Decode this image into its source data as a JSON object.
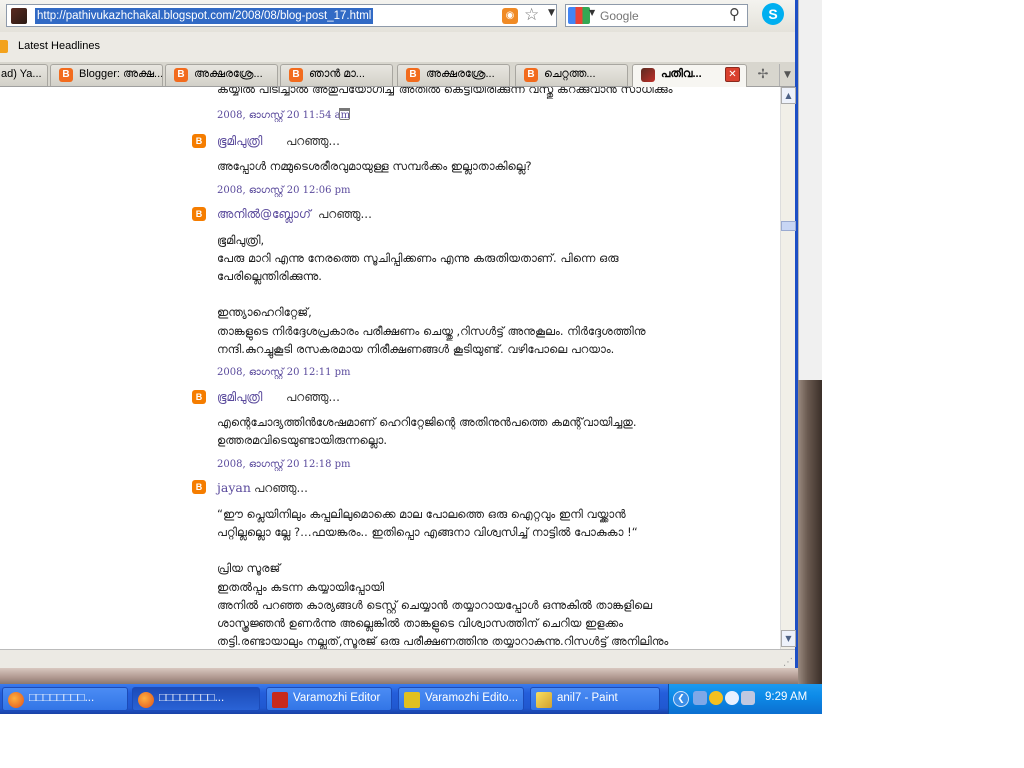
{
  "browser": {
    "url": "http://pathivukazhchakal.blogspot.com/2008/08/blog-post_17.html",
    "search_placeholder": "Google",
    "bookmarks": {
      "item": "Latest Headlines"
    },
    "tabs": [
      {
        "label": "ad) Ya..."
      },
      {
        "label": "Blogger: അക്ഷ..."
      },
      {
        "label": "അക്ഷരശ്രേ..."
      },
      {
        "label": "ഞാൻ മാ..."
      },
      {
        "label": "അക്ഷരശ്രേ..."
      },
      {
        "label": "ചെറ്റത്ത..."
      },
      {
        "label": "പതിവ..."
      }
    ]
  },
  "comments": {
    "c0": {
      "text": "കയ്യിൽ പിടിച്ചാൽ അതുപയോഗിച്ച് അതിൽ കെട്ടിയിരിക്കുന്ന വസ്തു കറക്കുവാൻ സാധിക്കും",
      "time": "2008, ഓഗസ്റ്റ് 20 11:54 am"
    },
    "c1": {
      "author": "ഭൂമിപുത്രി",
      "said": "പറഞ്ഞു...",
      "lines": [
        "അപ്പോൾ നമ്മുടെശരീരവുമായുള്ള സമ്പർക്കം ഇല്ലാതാകില്ലെ?"
      ],
      "time": "2008, ഓഗസ്റ്റ് 20 12:06 pm"
    },
    "c2": {
      "author": "അനിൽ@ബ്ലോഗ്",
      "said": "പറഞ്ഞു...",
      "lines": [
        "ഭൂമിപുത്രി,",
        "പേരു മാറി എന്നു നേരത്തെ സൂചിപ്പിക്കണം എന്നു കരുതിയതാണ്. പിന്നെ ഒരു",
        "പേരില്ലെന്തിരിക്കുന്നു.",
        "ഇന്ത്യാഹെറിറ്റേജ്,",
        "താങ്കളുടെ നിർദ്ദേശപ്രകാരം പരീക്ഷണം ചെയ്തു ,റിസൾട്ട് അനുകൂലം. നിർദ്ദേശത്തിനു",
        "നന്ദി.കുറച്ചുകൂടി രസകരമായ നിരീക്ഷണങ്ങൾ കൂടിയുണ്ട്. വഴിപോലെ പറയാം."
      ],
      "time": "2008, ഓഗസ്റ്റ് 20 12:11 pm"
    },
    "c3": {
      "author": "ഭൂമിപുത്രി",
      "said": "പറഞ്ഞു...",
      "lines": [
        "എന്റെചോദ്യത്തിൻശേഷമാണ് ഹെറിറ്റേജിന്റെ അതിനുൻപത്തെ കമന്റ്‌വായിച്ചതു.",
        "ഉത്തരമവിടെയുണ്ടായിരുന്നല്ലൊ."
      ],
      "time": "2008, ഓഗസ്റ്റ് 20 12:18 pm"
    },
    "c4": {
      "author": "jayan",
      "said": "പറഞ്ഞു...",
      "lines": [
        "“ഈ പ്ലെയിനിലും കപ്പലിലുമൊക്കെ മാല പോലത്തെ ഒരു ഐറ്റവും ഇനി വയ്ക്കാൻ",
        "പറ്റില്ലല്ലൊ ല്ലേ ?…ഫയങ്കരം.. ഇതിപ്പൊ എങ്ങനാ വിശ്വസിച്ച് നാട്ടിൽ പോകുകാ !“",
        "പ്രിയ സൂരജ്",
        "ഇതൽപ്പം കടന്ന കയ്യായിപ്പോയി",
        "അനിൽ പറഞ്ഞ കാര്യങ്ങൾ ടെസ്റ്റ് ചെയ്യാൻ തയ്യാറായപ്പോൾ ഒന്നുകിൽ താങ്കളിലെ",
        "ശാസ്ത്രജ്ഞൻ ഉണർന്നു അല്ലെങ്കിൽ താങ്കളുടെ വിശ്വാസത്തിന് ചെറിയ ഇളക്കം",
        "തട്ടി.രണ്ടായാലും നല്ലത്,സൂരജ് ഒരു പരീക്ഷണത്തിനു തയ്യാറാകുന്നു.റിസൾട്ട് അനിലിനും"
      ]
    }
  },
  "taskbar": {
    "tasks": [
      {
        "label": "□□□□□□□□..."
      },
      {
        "label": "□□□□□□□□..."
      },
      {
        "label": "Varamozhi Editor"
      },
      {
        "label": "Varamozhi Edito..."
      },
      {
        "label": "anil7 - Paint"
      }
    ],
    "clock": "9:29 AM"
  }
}
